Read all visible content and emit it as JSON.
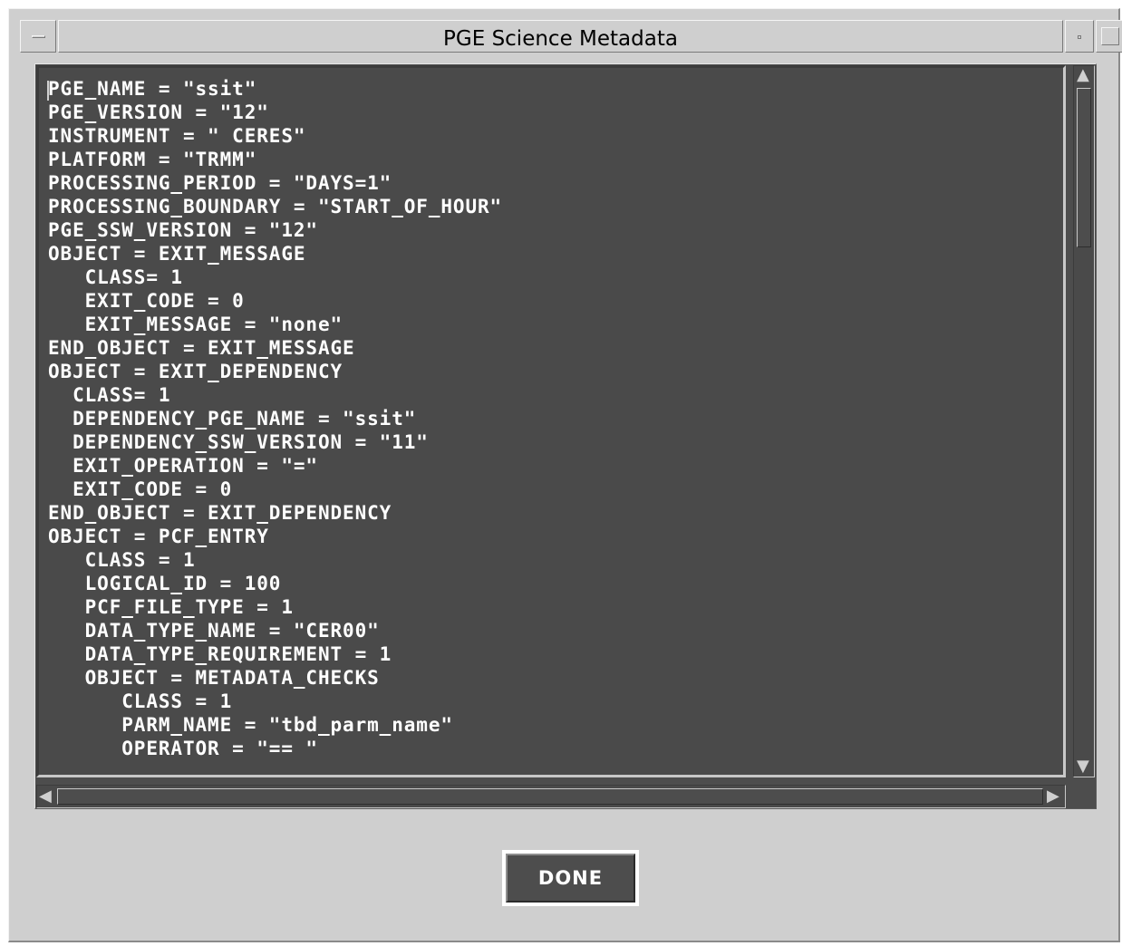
{
  "window": {
    "title": "PGE Science Metadata"
  },
  "metadata_text": {
    "lines": [
      "PGE_NAME = \"ssit\"",
      "PGE_VERSION = \"12\"",
      "INSTRUMENT = \" CERES\"",
      "PLATFORM = \"TRMM\"",
      "PROCESSING_PERIOD = \"DAYS=1\"",
      "PROCESSING_BOUNDARY = \"START_OF_HOUR\"",
      "PGE_SSW_VERSION = \"12\"",
      "OBJECT = EXIT_MESSAGE",
      "   CLASS= 1",
      "   EXIT_CODE = 0",
      "   EXIT_MESSAGE = \"none\"",
      "END_OBJECT = EXIT_MESSAGE",
      "OBJECT = EXIT_DEPENDENCY",
      "  CLASS= 1",
      "  DEPENDENCY_PGE_NAME = \"ssit\"",
      "  DEPENDENCY_SSW_VERSION = \"11\"",
      "  EXIT_OPERATION = \"=\"",
      "  EXIT_CODE = 0",
      "END_OBJECT = EXIT_DEPENDENCY",
      "OBJECT = PCF_ENTRY",
      "   CLASS = 1",
      "   LOGICAL_ID = 100",
      "   PCF_FILE_TYPE = 1",
      "   DATA_TYPE_NAME = \"CER00\"",
      "   DATA_TYPE_REQUIREMENT = 1",
      "   OBJECT = METADATA_CHECKS",
      "      CLASS = 1",
      "      PARM_NAME = \"tbd_parm_name\"",
      "      OPERATOR = \"== \""
    ]
  },
  "buttons": {
    "done_label": "DONE"
  },
  "icons": {
    "window_menu": "window-menu-icon",
    "minimize": "minimize-icon",
    "maximize": "maximize-icon",
    "scroll_up": "scroll-up-arrow-icon",
    "scroll_down": "scroll-down-arrow-icon",
    "scroll_left": "scroll-left-arrow-icon",
    "scroll_right": "scroll-right-arrow-icon"
  }
}
